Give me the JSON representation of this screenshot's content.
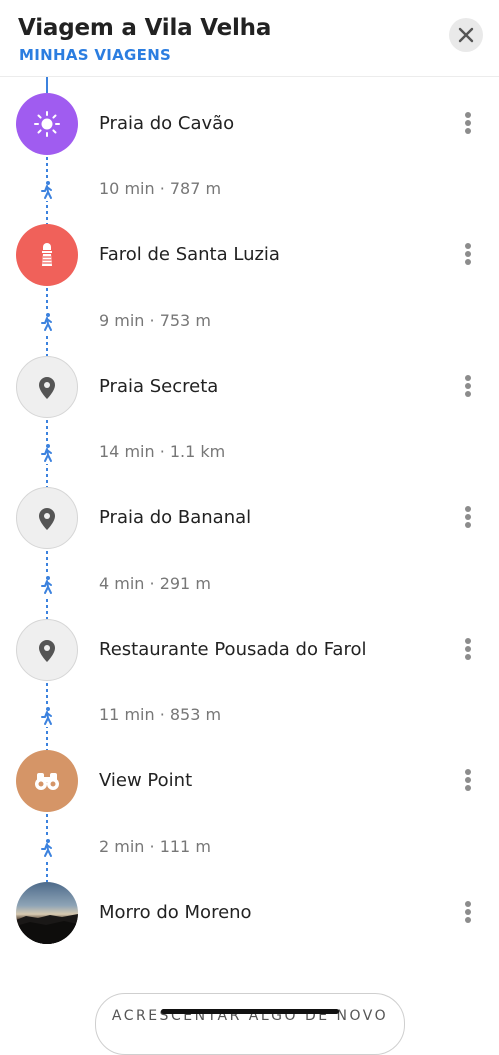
{
  "header": {
    "title": "Viagem a Vila Velha",
    "subtitle": "MINHAS VIAGENS"
  },
  "stops": [
    {
      "name": "Praia do Cavão",
      "icon": "sun-icon",
      "color": "#a05cf0"
    },
    {
      "name": "Farol de Santa Luzia",
      "icon": "lighthouse-icon",
      "color": "#f0615a"
    },
    {
      "name": "Praia Secreta",
      "icon": "location-pin-icon",
      "color": "#efefef"
    },
    {
      "name": "Praia do Bananal",
      "icon": "location-pin-icon",
      "color": "#efefef"
    },
    {
      "name": "Restaurante Pousada do Farol",
      "icon": "location-pin-icon",
      "color": "#efefef"
    },
    {
      "name": "View Point",
      "icon": "binoculars-icon",
      "color": "#d59567"
    },
    {
      "name": "Morro do Moreno",
      "icon": "photo-thumbnail",
      "color": "#3a4a5e"
    }
  ],
  "segments": [
    {
      "text": "10 min · 787 m"
    },
    {
      "text": "9 min · 753 m"
    },
    {
      "text": "14 min · 1.1 km"
    },
    {
      "text": "4 min · 291 m"
    },
    {
      "text": "11 min · 853 m"
    },
    {
      "text": "2 min · 111 m"
    }
  ],
  "add_button": {
    "label": "ACRESCENTAR ALGO DE NOVO"
  },
  "colors": {
    "accent": "#2b7de0",
    "route_line": "#3c82de"
  }
}
